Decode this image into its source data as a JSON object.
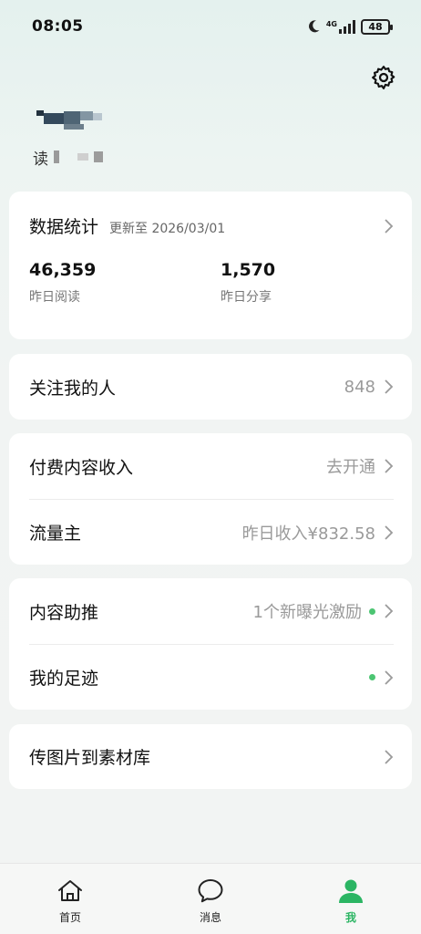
{
  "status_bar": {
    "time": "08:05",
    "network": "4G",
    "battery": "48"
  },
  "profile": {
    "name_label": "",
    "sub_label": "读"
  },
  "stats": {
    "title": "数据统计",
    "updated": "更新至 2026/03/01",
    "items": [
      {
        "value": "46,359",
        "label": "昨日阅读"
      },
      {
        "value": "1,570",
        "label": "昨日分享"
      }
    ]
  },
  "followers": {
    "title": "关注我的人",
    "value": "848"
  },
  "income": {
    "paid": {
      "title": "付费内容收入",
      "value": "去开通"
    },
    "traffic": {
      "title": "流量主",
      "value": "昨日收入¥832.58"
    }
  },
  "tools": {
    "promote": {
      "title": "内容助推",
      "value": "1个新曝光激励"
    },
    "footprint": {
      "title": "我的足迹",
      "value": ""
    }
  },
  "upload": {
    "title": "传图片到素材库"
  },
  "tabbar": {
    "home": "首页",
    "messages": "消息",
    "me": "我"
  },
  "colors": {
    "accent": "#2bb563",
    "dot": "#4cc572"
  }
}
